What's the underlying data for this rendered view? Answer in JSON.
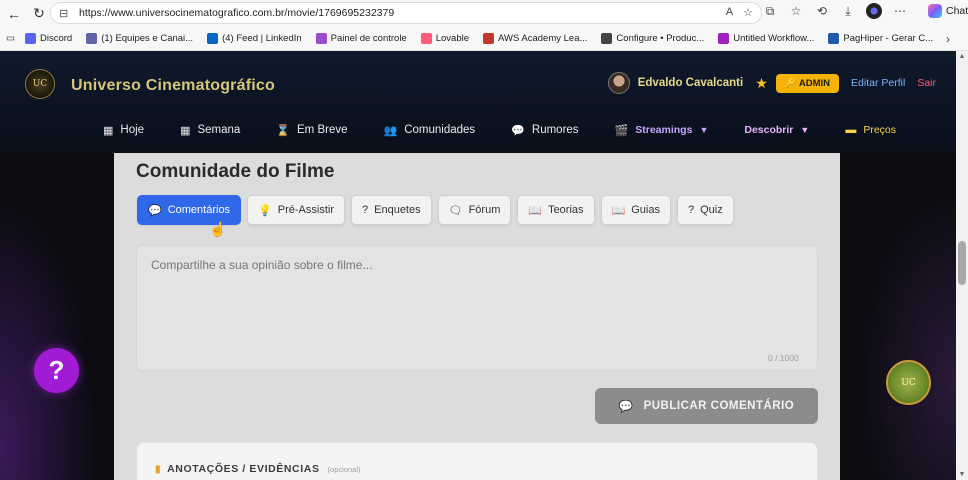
{
  "browser": {
    "url": "https://www.universocinematografico.com.br/movie/1769695232379",
    "copilot_label": "Chat",
    "bookmarks": [
      {
        "label": "Discord",
        "color": "#5865F2"
      },
      {
        "label": "(1) Equipes e Canai...",
        "color": "#6264A7"
      },
      {
        "label": "(4) Feed | LinkedIn",
        "color": "#0A66C2"
      },
      {
        "label": "Painel de controle",
        "color": "#9b4dca"
      },
      {
        "label": "Lovable",
        "color": "#ff5a7a"
      },
      {
        "label": "AWS Academy Lea...",
        "color": "#c0392b"
      },
      {
        "label": "Configure • Produc...",
        "color": "#444444"
      },
      {
        "label": "Untitled Workflow...",
        "color": "#a020c0"
      },
      {
        "label": "PagHiper - Gerar C...",
        "color": "#1e5aa8"
      }
    ]
  },
  "header": {
    "logo_text": "UC",
    "brand": "Universo Cinematográfico",
    "username": "Edvaldo Cavalcanti",
    "admin_label": "ADMIN",
    "edit_profile": "Editar Perfil",
    "logout": "Sair"
  },
  "nav": [
    {
      "label": "Hoje",
      "icon": "calendar-icon",
      "glyph": "▦"
    },
    {
      "label": "Semana",
      "icon": "calendar-week-icon",
      "glyph": "▦"
    },
    {
      "label": "Em Breve",
      "icon": "hourglass-icon",
      "glyph": "⌛"
    },
    {
      "label": "Comunidades",
      "icon": "people-icon",
      "glyph": "👥"
    },
    {
      "label": "Rumores",
      "icon": "chat-bubble-icon",
      "glyph": "💬"
    },
    {
      "label": "Streamings",
      "icon": "clapper-icon",
      "glyph": "🎬",
      "dropdown": "▼"
    },
    {
      "label": "Descobrir",
      "icon": "",
      "glyph": "",
      "dropdown": "▼"
    },
    {
      "label": "Preços",
      "icon": "ticket-icon",
      "glyph": "▬"
    }
  ],
  "community": {
    "title": "Comunidade do Filme",
    "tabs": [
      {
        "label": "Comentários",
        "glyph": "💬"
      },
      {
        "label": "Pré-Assistir",
        "glyph": "💡"
      },
      {
        "label": "Enquetes",
        "glyph": "?"
      },
      {
        "label": "Fórum",
        "glyph": "🗨"
      },
      {
        "label": "Teorias",
        "glyph": "📖"
      },
      {
        "label": "Guias",
        "glyph": "📖"
      },
      {
        "label": "Quiz",
        "glyph": "?"
      }
    ],
    "comment_placeholder": "Compartilhe a sua opinião sobre o filme...",
    "counter": "0 / 1000",
    "publish_label": "PUBLICAR COMENTÁRIO",
    "notes_title": "ANOTAÇÕES / EVIDÊNCIAS",
    "notes_optional": "(opcional)"
  },
  "help_label": "?",
  "colors": {
    "accent_blue": "#2f68e8",
    "brand_gold": "#d6c57a",
    "admin_yellow": "#f5b30a",
    "help_purple": "#a21bd4"
  }
}
